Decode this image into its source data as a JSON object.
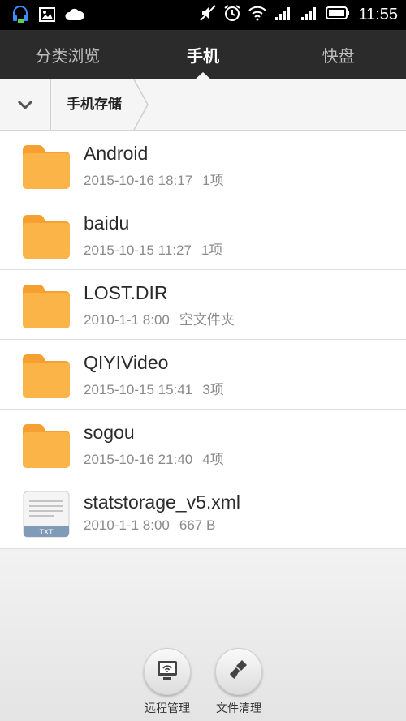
{
  "status_bar": {
    "time": "11:55",
    "left_icons": [
      "headset-notification-icon",
      "image-notification-icon",
      "cloud-notification-icon"
    ],
    "right_icons": [
      "mute-icon",
      "alarm-icon",
      "wifi-icon",
      "signal-icon",
      "signal-icon",
      "battery-icon"
    ]
  },
  "tabs": [
    {
      "label": "分类浏览",
      "active": false
    },
    {
      "label": "手机",
      "active": true
    },
    {
      "label": "快盘",
      "active": false
    }
  ],
  "breadcrumb": {
    "current": "手机存储"
  },
  "files": [
    {
      "name": "Android",
      "date": "2015-10-16 18:17",
      "info": "1项",
      "type": "folder"
    },
    {
      "name": "baidu",
      "date": "2015-10-15 11:27",
      "info": "1项",
      "type": "folder"
    },
    {
      "name": "LOST.DIR",
      "date": "2010-1-1 8:00",
      "info": "空文件夹",
      "type": "folder"
    },
    {
      "name": "QIYIVideo",
      "date": "2015-10-15 15:41",
      "info": "3项",
      "type": "folder"
    },
    {
      "name": "sogou",
      "date": "2015-10-16 21:40",
      "info": "4项",
      "type": "folder"
    },
    {
      "name": "statstorage_v5.xml",
      "date": "2010-1-1 8:00",
      "info": "667 B",
      "type": "txt",
      "icon_label": "TXT"
    }
  ],
  "actions": [
    {
      "label": "远程管理",
      "icon": "remote-monitor-icon"
    },
    {
      "label": "文件清理",
      "icon": "broom-icon"
    }
  ],
  "colors": {
    "folder": "#f7a83a",
    "tab_bar": "#2b2b2b",
    "status_bar": "#000000"
  }
}
